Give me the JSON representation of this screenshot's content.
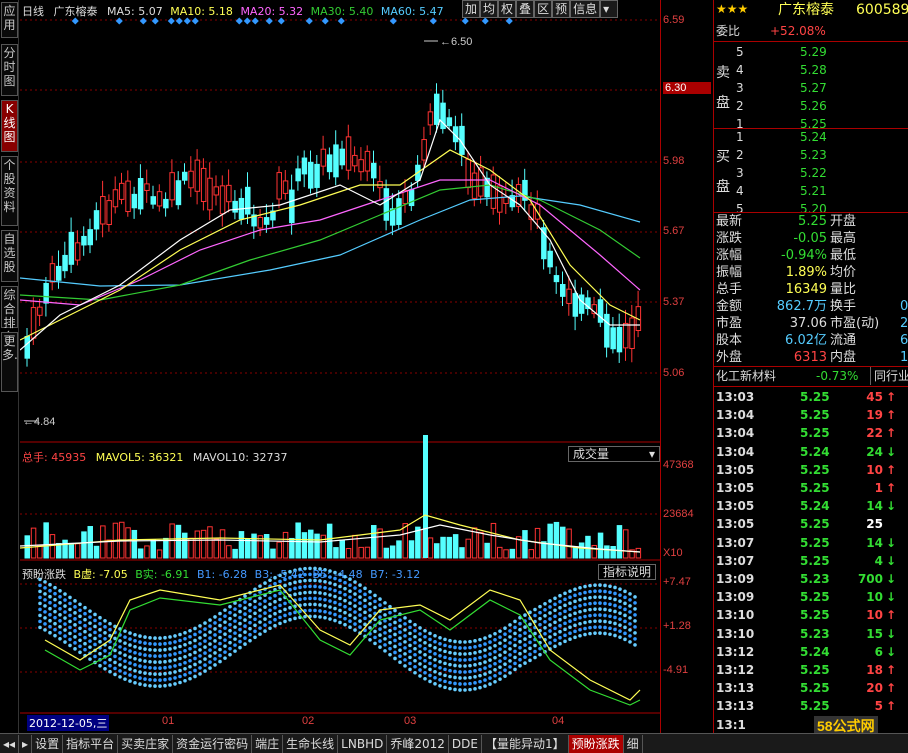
{
  "lefttabs": [
    {
      "label": "应用"
    },
    {
      "label": "分时图"
    },
    {
      "label": "K线图",
      "active": true
    },
    {
      "label": "个股资料"
    },
    {
      "label": "自选股"
    },
    {
      "label": "综合排名"
    },
    {
      "label": "更多."
    }
  ],
  "header": {
    "period": "日线",
    "stock": "广东榕泰",
    "ma5": "MA5: 5.07",
    "ma10": "MA10: 5.18",
    "ma20": "MA20: 5.32",
    "ma30": "MA30: 5.40",
    "ma60": "MA60: 5.47"
  },
  "toolbar": [
    "加",
    "均",
    "权",
    "叠",
    "区",
    "预",
    "信息"
  ],
  "price_axis": [
    "6.59",
    "6.30",
    "5.98",
    "5.67",
    "5.37",
    "5.06"
  ],
  "price_high_label": "6.50",
  "price_low_label": "4.84",
  "volume": {
    "total": "总手: 45935",
    "mavol5": "MAVOL5: 36321",
    "mavol10": "MAVOL10: 32737",
    "dropdown": "成交量",
    "axis": [
      "47368",
      "23684",
      "X10"
    ]
  },
  "indicator": {
    "name": "预盼涨跌",
    "b_empty": "B虚: -7.05",
    "b_real": "B实: -6.91",
    "b1": "B1: -6.28",
    "b3": "B3: -5.42",
    "b5": "B5: -4.48",
    "b7": "B7: -3.12",
    "explain": "指标说明",
    "axis": [
      "+7.47",
      "+1.28",
      "-4.91"
    ]
  },
  "date_axis": {
    "current": "2012-12-05,三",
    "months": [
      "01",
      "02",
      "03",
      "04"
    ]
  },
  "panel": {
    "title": "广东榕泰",
    "code": "600589",
    "weibi_label": "委比",
    "weibi": "+52.08%",
    "sell_label": [
      "卖",
      "盘"
    ],
    "buy_label": [
      "买",
      "盘"
    ],
    "sell": [
      {
        "n": "5",
        "p": "5.29"
      },
      {
        "n": "4",
        "p": "5.28"
      },
      {
        "n": "3",
        "p": "5.27"
      },
      {
        "n": "2",
        "p": "5.26"
      },
      {
        "n": "1",
        "p": "5.25"
      }
    ],
    "buy": [
      {
        "n": "1",
        "p": "5.24"
      },
      {
        "n": "2",
        "p": "5.23"
      },
      {
        "n": "3",
        "p": "5.22"
      },
      {
        "n": "4",
        "p": "5.21"
      },
      {
        "n": "5",
        "p": "5.20"
      }
    ],
    "quotes": [
      {
        "k1": "最新",
        "v1": "5.25",
        "k2": "开盘",
        "c": "#33dd33"
      },
      {
        "k1": "涨跌",
        "v1": "-0.05",
        "k2": "最高",
        "c": "#33dd33"
      },
      {
        "k1": "涨幅",
        "v1": "-0.94%",
        "k2": "最低",
        "c": "#33dd33"
      },
      {
        "k1": "振幅",
        "v1": "1.89%",
        "k2": "均价",
        "c": "#ffff55"
      },
      {
        "k1": "总手",
        "v1": "16349",
        "k2": "量比",
        "c": "#ffff55"
      },
      {
        "k1": "金额",
        "v1": "862.7万",
        "k2": "换手",
        "c": "#55ccff",
        "r": "0"
      },
      {
        "k1": "市盈",
        "v1": "37.06",
        "k2": "市盈(动)",
        "c": "#dddddd",
        "r": "2"
      },
      {
        "k1": "股本",
        "v1": "6.02亿",
        "k2": "流通",
        "c": "#55ccff",
        "r": "6."
      },
      {
        "k1": "外盘",
        "v1": "6313",
        "k2": "内盘",
        "c": "#ff4444",
        "r": "1"
      }
    ],
    "sector": "化工新材料",
    "sector_change": "-0.73%",
    "sector_tab": "同行业",
    "ticks": [
      {
        "t": "13:03",
        "p": "5.25",
        "v": "45",
        "d": "up"
      },
      {
        "t": "13:04",
        "p": "5.25",
        "v": "19",
        "d": "up"
      },
      {
        "t": "13:04",
        "p": "5.25",
        "v": "22",
        "d": "up"
      },
      {
        "t": "13:04",
        "p": "5.24",
        "v": "24",
        "d": "down"
      },
      {
        "t": "13:05",
        "p": "5.25",
        "v": "10",
        "d": "up"
      },
      {
        "t": "13:05",
        "p": "5.25",
        "v": "1",
        "d": "up"
      },
      {
        "t": "13:05",
        "p": "5.24",
        "v": "14",
        "d": "down"
      },
      {
        "t": "13:05",
        "p": "5.25",
        "v": "25",
        "d": "flat"
      },
      {
        "t": "13:07",
        "p": "5.25",
        "v": "14",
        "d": "down"
      },
      {
        "t": "13:07",
        "p": "5.25",
        "v": "4",
        "d": "down"
      },
      {
        "t": "13:09",
        "p": "5.23",
        "v": "700",
        "d": "down"
      },
      {
        "t": "13:09",
        "p": "5.25",
        "v": "10",
        "d": "down"
      },
      {
        "t": "13:10",
        "p": "5.25",
        "v": "10",
        "d": "up"
      },
      {
        "t": "13:10",
        "p": "5.23",
        "v": "15",
        "d": "down"
      },
      {
        "t": "13:12",
        "p": "5.24",
        "v": "6",
        "d": "down"
      },
      {
        "t": "13:12",
        "p": "5.25",
        "v": "18",
        "d": "up"
      },
      {
        "t": "13:13",
        "p": "5.25",
        "v": "20",
        "d": "up"
      },
      {
        "t": "13:13",
        "p": "5.25",
        "v": "5",
        "d": "up"
      },
      {
        "t": "13:1",
        "p": "",
        "v": "",
        "d": ""
      }
    ]
  },
  "bottombar": [
    "设置",
    "指标平台",
    "买卖庄家",
    "资金运行密码",
    "端庄",
    "生命长线",
    "LNBHD",
    "乔峰2012",
    "DDE",
    "【量能异动1】",
    "预盼涨跌",
    "细"
  ],
  "watermark": "58公式网",
  "colors": {
    "up": "#ff3333",
    "down": "#33dd33",
    "cyan": "#55ffff",
    "yellow": "#ffff55",
    "axis_red": "#aa0000"
  }
}
